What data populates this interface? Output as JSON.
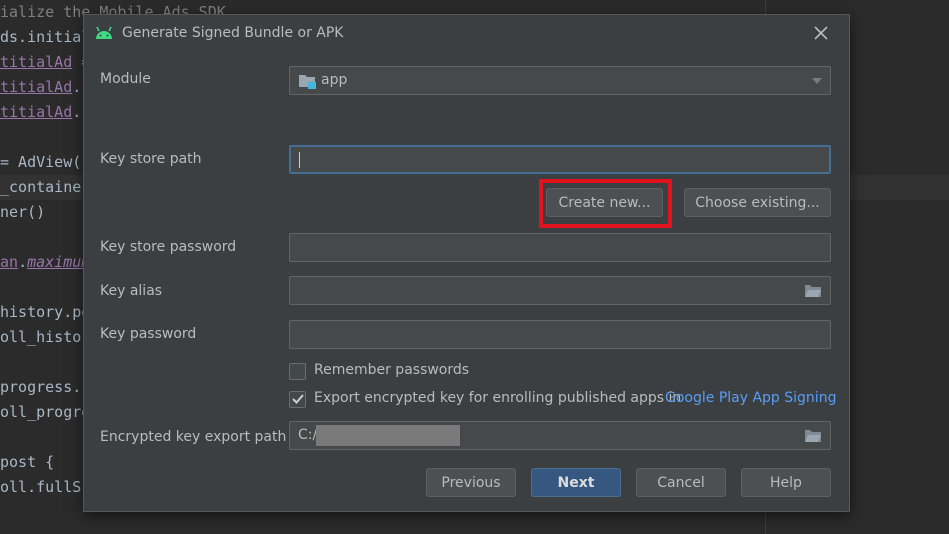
{
  "editor": {
    "lines": [
      {
        "pre": "ialize the Mobile Ads SDK",
        "purple": "",
        "post": "",
        "comment": true
      },
      {
        "pre": "ds.initial",
        "purple": "",
        "post": ""
      },
      {
        "pre": "",
        "purple": "titialAd",
        "post": " ="
      },
      {
        "pre": "",
        "purple": "titialAd",
        "post": "."
      },
      {
        "pre": "",
        "purple": "titialAd",
        "post": "."
      },
      {
        "pre": "",
        "purple": "",
        "post": ""
      },
      {
        "pre": "= AdView(",
        "purple": "",
        "post": ""
      },
      {
        "pre": "_containe",
        "purple": "",
        "post": ""
      },
      {
        "pre": "ner()",
        "purple": "",
        "post": ""
      },
      {
        "pre": "",
        "purple": "",
        "post": ""
      },
      {
        "pre": "",
        "purple": "an",
        "post": ".",
        "italic": "maximum"
      },
      {
        "pre": "",
        "purple": "",
        "post": ""
      },
      {
        "pre": "history.po",
        "purple": "",
        "post": ""
      },
      {
        "pre": "oll_histo",
        "purple": "",
        "post": ""
      },
      {
        "pre": "",
        "purple": "",
        "post": ""
      },
      {
        "pre": "progress.",
        "purple": "",
        "post": ""
      },
      {
        "pre": "oll_progre",
        "purple": "",
        "post": ""
      },
      {
        "pre": "",
        "purple": "",
        "post": ""
      },
      {
        "pre": "post {",
        "purple": "",
        "post": ""
      },
      {
        "pre": "oll.fullS",
        "purple": "",
        "post": ""
      }
    ]
  },
  "dialog": {
    "title": "Generate Signed Bundle or APK",
    "module_label": "Module",
    "module_value": "app",
    "keystore_path_label": "Key store path",
    "keystore_path_value": "",
    "create_new_label": "Create new...",
    "choose_existing_label": "Choose existing...",
    "keystore_password_label": "Key store password",
    "key_alias_label": "Key alias",
    "key_password_label": "Key password",
    "remember_passwords_label": "Remember passwords",
    "remember_passwords_checked": false,
    "export_key_label": "Export encrypted key for enrolling published apps in",
    "export_key_checked": true,
    "play_signing_link": "Google Play App Signing",
    "export_path_label": "Encrypted key export path",
    "export_path_value": "C:/",
    "previous_label": "Previous",
    "next_label": "Next",
    "cancel_label": "Cancel",
    "help_label": "Help"
  },
  "colors": {
    "accent": "#365880",
    "link": "#589df6",
    "highlight": "#e0121e",
    "android_green": "#3ddc84"
  }
}
